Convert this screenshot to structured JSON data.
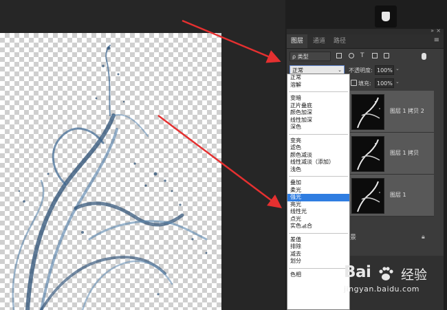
{
  "panel": {
    "tabs": [
      "图层",
      "通道",
      "路径"
    ],
    "filter_label": "ρ 类型",
    "blend_mode": "正常",
    "opacity_label": "不透明度:",
    "opacity_value": "100%",
    "fill_label": "填充:",
    "fill_value": "100%",
    "layers": [
      {
        "name": "图层 1 拷贝 2"
      },
      {
        "name": "图层 1 拷贝"
      },
      {
        "name": "图层 1"
      }
    ],
    "background_fragment": "景"
  },
  "dropdown": {
    "groups": [
      [
        "正常",
        "溶解"
      ],
      [
        "变暗",
        "正片叠底",
        "颜色加深",
        "线性加深",
        "深色"
      ],
      [
        "变亮",
        "滤色",
        "颜色减淡",
        "线性减淡（添加）",
        "浅色"
      ],
      [
        "叠加",
        "柔光",
        "强光",
        "亮光",
        "线性光",
        "点光",
        "实色混合"
      ],
      [
        "差值",
        "排除",
        "减去",
        "划分"
      ],
      [
        "色相"
      ]
    ],
    "selected": "强光"
  },
  "watermark": {
    "logo": "Bai",
    "logo_suffix": "经验",
    "url": "jingyan.baidu.com"
  },
  "colors": {
    "arrow": "#e53030",
    "selection": "#2f7de1",
    "water": "#2b4f74"
  }
}
